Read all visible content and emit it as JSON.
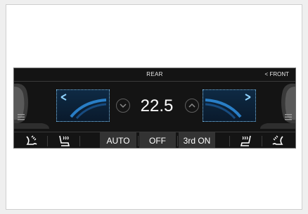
{
  "header": {
    "title": "REAR",
    "front_button": "< FRONT"
  },
  "temperature": {
    "value": "22.5"
  },
  "modes": {
    "auto": "AUTO",
    "off": "OFF",
    "third_row": "3rd ON"
  },
  "colors": {
    "accent": "#4fb3f6",
    "panel": "#141414"
  },
  "icons": {
    "left_vent": "airflow-left-icon",
    "right_vent": "airflow-right-icon",
    "temp_down": "chevron-down-icon",
    "temp_up": "chevron-up-icon",
    "menu": "menu-icon",
    "seat_warmer": "seat-heat-icon",
    "fan": "fan-icon"
  }
}
